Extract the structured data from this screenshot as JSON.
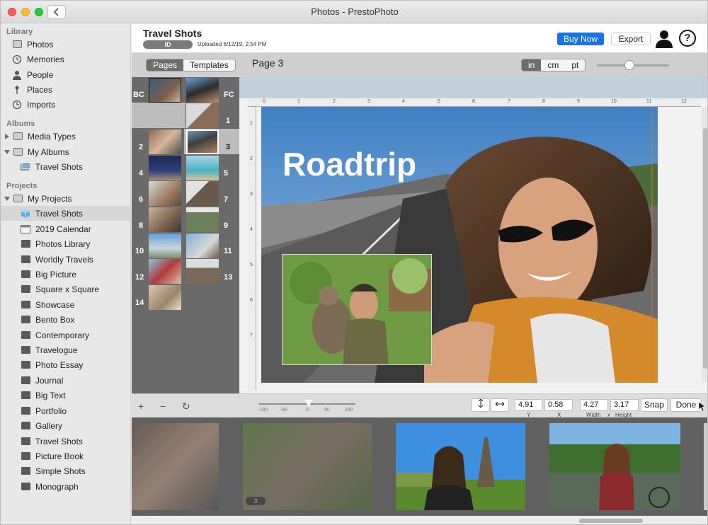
{
  "window": {
    "title": "Photos - PrestoPhoto"
  },
  "sidebar": {
    "library_header": "Library",
    "library": [
      {
        "label": "Photos",
        "icon": "photos-icon"
      },
      {
        "label": "Memories",
        "icon": "memories-icon"
      },
      {
        "label": "People",
        "icon": "people-icon"
      },
      {
        "label": "Places",
        "icon": "places-icon"
      },
      {
        "label": "Imports",
        "icon": "imports-icon"
      }
    ],
    "albums_header": "Albums",
    "albums": [
      {
        "label": "Media Types"
      },
      {
        "label": "My Albums"
      },
      {
        "label": "Travel Shots"
      }
    ],
    "projects_header": "Projects",
    "projects": [
      {
        "label": "My Projects"
      },
      {
        "label": "Travel Shots",
        "selected": true
      },
      {
        "label": "2019 Calendar"
      },
      {
        "label": "Photos Library"
      },
      {
        "label": "Worldly Travels"
      },
      {
        "label": "Big Picture"
      },
      {
        "label": "Square x Square"
      },
      {
        "label": "Showcase"
      },
      {
        "label": "Bento Box"
      },
      {
        "label": "Contemporary"
      },
      {
        "label": "Travelogue"
      },
      {
        "label": "Photo Essay"
      },
      {
        "label": "Journal"
      },
      {
        "label": "Big Text"
      },
      {
        "label": "Portfolio"
      },
      {
        "label": "Gallery"
      },
      {
        "label": "Travel Shots"
      },
      {
        "label": "Picture Book"
      },
      {
        "label": "Simple Shots"
      },
      {
        "label": "Monograph"
      }
    ]
  },
  "header": {
    "title": "Travel Shots",
    "id_badge": "ID",
    "uploaded": "Uploaded 6/12/19, 2:54 PM",
    "buy_now": "Buy Now",
    "export": "Export"
  },
  "toolbar": {
    "tab_pages": "Pages",
    "tab_templates": "Templates",
    "page_label": "Page 3",
    "unit_in": "in",
    "unit_cm": "cm",
    "unit_pt": "pt",
    "zoom_level": 0.44
  },
  "pages_panel": {
    "labels": [
      "BC",
      "FC",
      "1",
      "2",
      "3",
      "4",
      "5",
      "6",
      "7",
      "8",
      "9",
      "10",
      "11",
      "12",
      "13",
      "14"
    ]
  },
  "ruler": {
    "h_ticks": [
      "0",
      "1",
      "2",
      "3",
      "4",
      "5",
      "6",
      "7",
      "8",
      "9",
      "10",
      "11",
      "12"
    ],
    "v_ticks": [
      "1",
      "2",
      "3",
      "4",
      "5",
      "6",
      "7"
    ]
  },
  "page": {
    "title_text": "Roadtrip"
  },
  "bottom": {
    "rotation_labels": [
      "-180",
      "-90",
      "0",
      "90",
      "180"
    ],
    "y_value": "4.91",
    "x_value": "0.58",
    "width_value": "4.27",
    "height_value": "3.17",
    "y_caption": "Y",
    "x_caption": "X",
    "width_caption": "Width",
    "x_sep": "x",
    "height_caption": "Height",
    "snap": "Snap",
    "done": "Done"
  },
  "strip": {
    "badge": "3"
  }
}
